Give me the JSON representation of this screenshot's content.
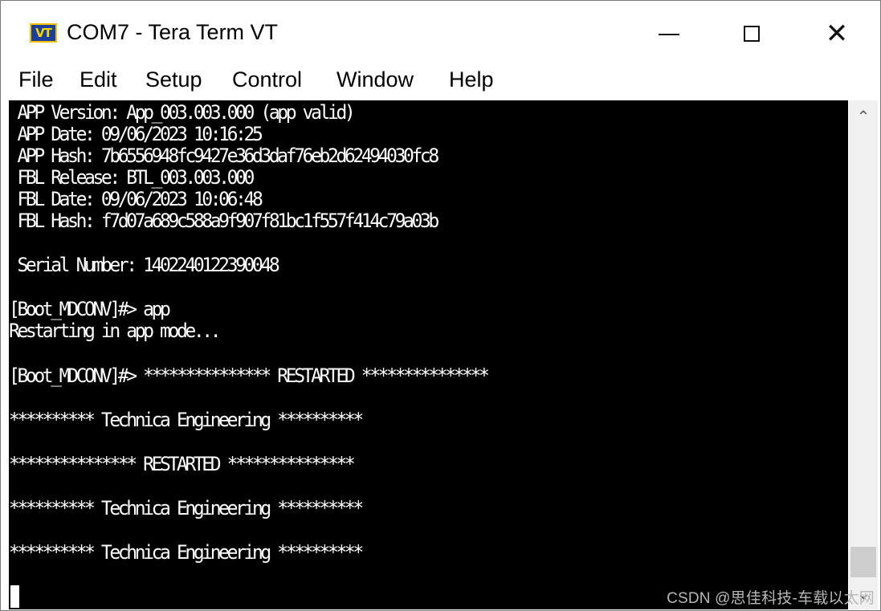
{
  "window": {
    "app_icon_text": "VT",
    "title": "COM7 - Tera Term VT",
    "minimize_glyph": "",
    "close_glyph": "✕"
  },
  "menu": [
    "File",
    "Edit",
    "Setup",
    "Control",
    "Window",
    "Help"
  ],
  "terminal": {
    "lines": [
      " APP Version: App_003.003.000 (app valid)",
      " APP Date: 09/06/2023 10:16:25",
      " APP Hash: 7b6556948fc9427e36d3daf76eb2d62494030fc8",
      " FBL Release: BTL_003.003.000",
      " FBL Date: 09/06/2023 10:06:48",
      " FBL Hash: f7d07a689c588a9f907f81bc1f557f414c79a03b",
      "",
      " Serial Number: 1402240122390048",
      "",
      "[Boot_MDCONV]#> app",
      "Restarting in app mode...",
      "",
      "[Boot_MDCONV]#> *************** RESTARTED ***************",
      "",
      "********** Technica Engineering **********",
      "",
      "*************** RESTARTED ***************",
      "",
      "********** Technica Engineering **********",
      "",
      "********** Technica Engineering **********",
      "",
      ""
    ]
  },
  "scrollbar": {
    "up_glyph": "⌃",
    "down_glyph": "⌄"
  },
  "watermark": "CSDN @思佳科技-车载以太网"
}
